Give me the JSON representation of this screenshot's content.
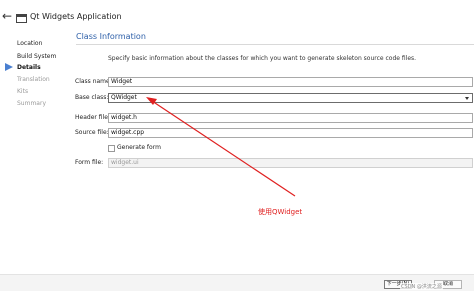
{
  "window": {
    "title": "Qt Widgets Application",
    "back_glyph": "←"
  },
  "sidebar": {
    "items": [
      {
        "label": "Location",
        "state": "done"
      },
      {
        "label": "Build System",
        "state": "done"
      },
      {
        "label": "Details",
        "state": "current"
      },
      {
        "label": "Translation",
        "state": "pending"
      },
      {
        "label": "Kits",
        "state": "pending"
      },
      {
        "label": "Summary",
        "state": "pending"
      }
    ]
  },
  "page": {
    "title": "Class Information",
    "description": "Specify basic information about the classes for which you want to generate skeleton source code files."
  },
  "form": {
    "class_name": {
      "label": "Class name:",
      "value": "Widget"
    },
    "base_class": {
      "label": "Base class:",
      "value": "QWidget"
    },
    "header_file": {
      "label": "Header file:",
      "value": "widget.h"
    },
    "source_file": {
      "label": "Source file:",
      "value": "widget.cpp"
    },
    "generate_form": {
      "label": "Generate form",
      "checked": false
    },
    "form_file": {
      "label": "Form file:",
      "value": "widget.ui"
    }
  },
  "annotation": {
    "text": "使用QWidget",
    "color": "#e02020"
  },
  "buttons": {
    "next": "下一步(N)",
    "cancel": "取消"
  },
  "watermark": "CSDN @洪流之源",
  "colors": {
    "accent": "#2d5fa8",
    "sidebar_marker": "#4a7fd0",
    "annotation": "#e02020"
  },
  "icons": {
    "back": "arrow-left-icon",
    "app": "window-icon",
    "dropdown": "chevron-down-icon"
  }
}
